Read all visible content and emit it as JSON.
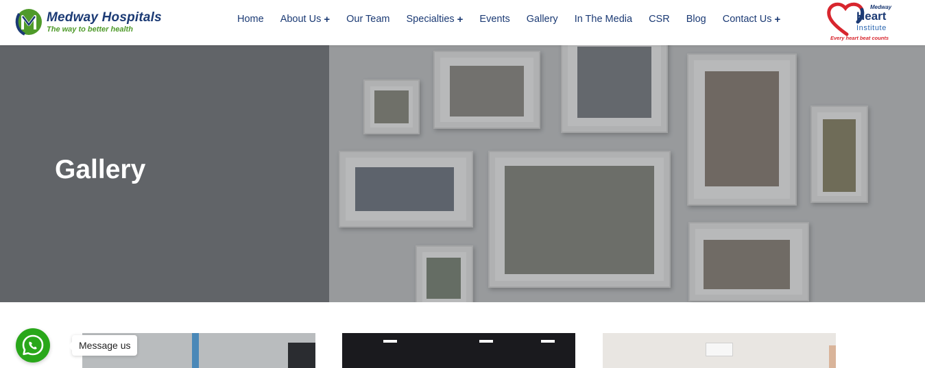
{
  "brand": {
    "name": "Medway Hospitals",
    "tagline": "The way to better health"
  },
  "nav": [
    {
      "label": "Home",
      "has_submenu": false
    },
    {
      "label": "About Us",
      "has_submenu": true
    },
    {
      "label": "Our Team",
      "has_submenu": false
    },
    {
      "label": "Specialties",
      "has_submenu": true
    },
    {
      "label": "Events",
      "has_submenu": false
    },
    {
      "label": "Gallery",
      "has_submenu": false
    },
    {
      "label": "In The Media",
      "has_submenu": false
    },
    {
      "label": "CSR",
      "has_submenu": false
    },
    {
      "label": "Blog",
      "has_submenu": false
    },
    {
      "label": "Contact Us",
      "has_submenu": true
    }
  ],
  "submenu_indicator": "+",
  "heart_institute": {
    "small": "Medway",
    "name": "Heart",
    "sub": "Institute",
    "tagline": "Every heart beat counts"
  },
  "hero": {
    "title": "Gallery"
  },
  "whatsapp": {
    "label": "Message us",
    "icon": "whatsapp-icon"
  },
  "colors": {
    "brand_blue": "#1b3a74",
    "brand_green": "#4f9a2a",
    "heart_red": "#d8262e",
    "whatsapp_green": "#29a71a"
  }
}
